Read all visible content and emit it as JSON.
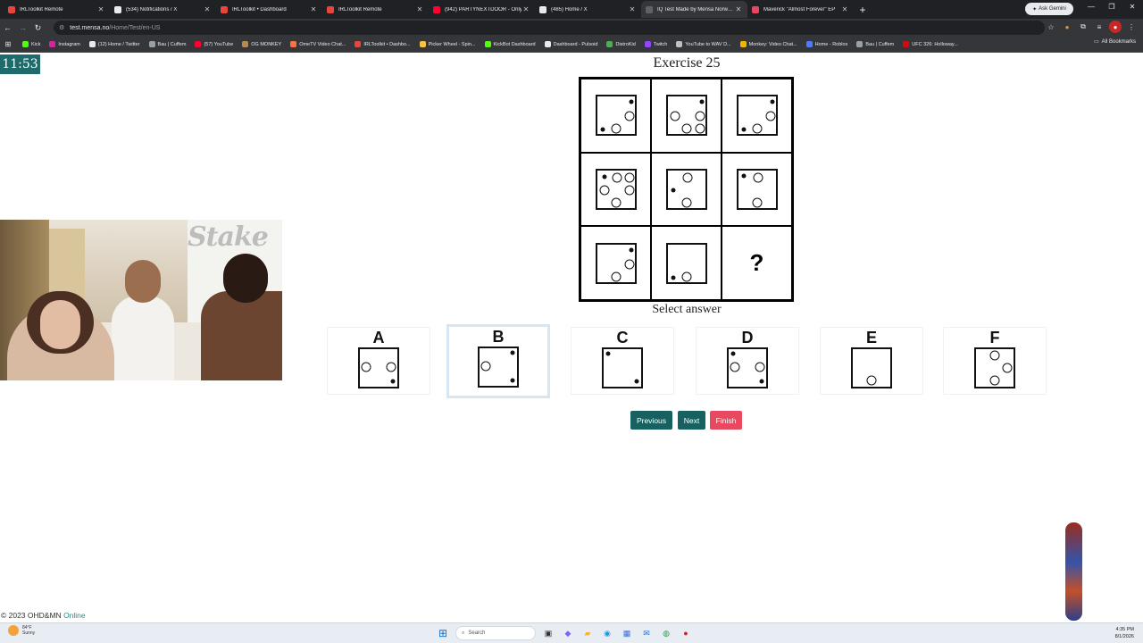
{
  "browser": {
    "tabs": [
      {
        "title": "IRLToolkit Remote",
        "color": "#e8453c"
      },
      {
        "title": "(534) Notifications / X",
        "color": "#e8eaed"
      },
      {
        "title": "IRLToolkit • Dashboard",
        "color": "#e8453c"
      },
      {
        "title": "IRLToolkit Remote",
        "color": "#e8453c"
      },
      {
        "title": "(942) PARTYNEXTDOOR - Only",
        "color": "#ff0033"
      },
      {
        "title": "(485) Home / X",
        "color": "#e8eaed"
      },
      {
        "title": "IQ Test Made by Mensa Norw…",
        "color": "#5f6368",
        "active": true
      },
      {
        "title": "Maverick \"Almost Forever\" EP",
        "color": "#e8455e"
      }
    ],
    "new_tab_icon": "+",
    "ask_gemini": "Ask Gemini",
    "window_controls": [
      "—",
      "❐",
      "✕"
    ],
    "url_host": "test.mensa.no",
    "url_path": "/Home/Test/en-US",
    "bookmarks": [
      {
        "label": "Kick",
        "color": "#53fc18"
      },
      {
        "label": "Instagram",
        "color": "#d6249f"
      },
      {
        "label": "(12) Home / Twitter",
        "color": "#e8eaed"
      },
      {
        "label": "Bau | Cuffem",
        "color": "#9aa0a6"
      },
      {
        "label": "(57) YouTube",
        "color": "#ff0033"
      },
      {
        "label": "OG MONKEY",
        "color": "#b68a52"
      },
      {
        "label": "OmeTV Video Chat...",
        "color": "#ff7043"
      },
      {
        "label": "IRLToolkit • Dashbo...",
        "color": "#e8453c"
      },
      {
        "label": "Picker Wheel - Spin...",
        "color": "#f6c344"
      },
      {
        "label": "KickBot Dashboard",
        "color": "#53fc18"
      },
      {
        "label": "Dashboard - Pulsoid",
        "color": "#e8eaed"
      },
      {
        "label": "DistroKid",
        "color": "#4caf50"
      },
      {
        "label": "Twitch",
        "color": "#9146ff"
      },
      {
        "label": "YouTube to WAV D...",
        "color": "#c0c0c0"
      },
      {
        "label": "Monkey: Video Chat...",
        "color": "#f4b400"
      },
      {
        "label": "Home - Roblox",
        "color": "#4d7cff"
      },
      {
        "label": "Bau | Cuffem",
        "color": "#9aa0a6"
      },
      {
        "label": "UFC 326: Holloway...",
        "color": "#d20a11"
      }
    ],
    "all_bookmarks": "All Bookmarks"
  },
  "page": {
    "timer": "11:53",
    "exercise_title": "Exercise 25",
    "question_mark": "?",
    "select_answer": "Select answer",
    "answers": [
      {
        "letter": "A",
        "selected": false
      },
      {
        "letter": "B",
        "selected": true
      },
      {
        "letter": "C",
        "selected": false
      },
      {
        "letter": "D",
        "selected": false
      },
      {
        "letter": "E",
        "selected": false
      },
      {
        "letter": "F",
        "selected": false
      }
    ],
    "buttons": {
      "previous": "Previous",
      "next": "Next",
      "finish": "Finish"
    },
    "footer_copyright": "© 2023 OHD&MN",
    "footer_status": "Online",
    "webcam_logo": "Stake"
  },
  "colors": {
    "timer_bg": "#1f6b6b",
    "nav_button": "#176161",
    "finish_button": "#e84860",
    "selected_border": "#d6e7f3",
    "online_text": "#2a8a82"
  },
  "taskbar": {
    "weather_temp": "84°F",
    "weather_desc": "Sunny",
    "search_placeholder": "Search",
    "time": "4:35 PM",
    "date": "8/1/2026"
  }
}
